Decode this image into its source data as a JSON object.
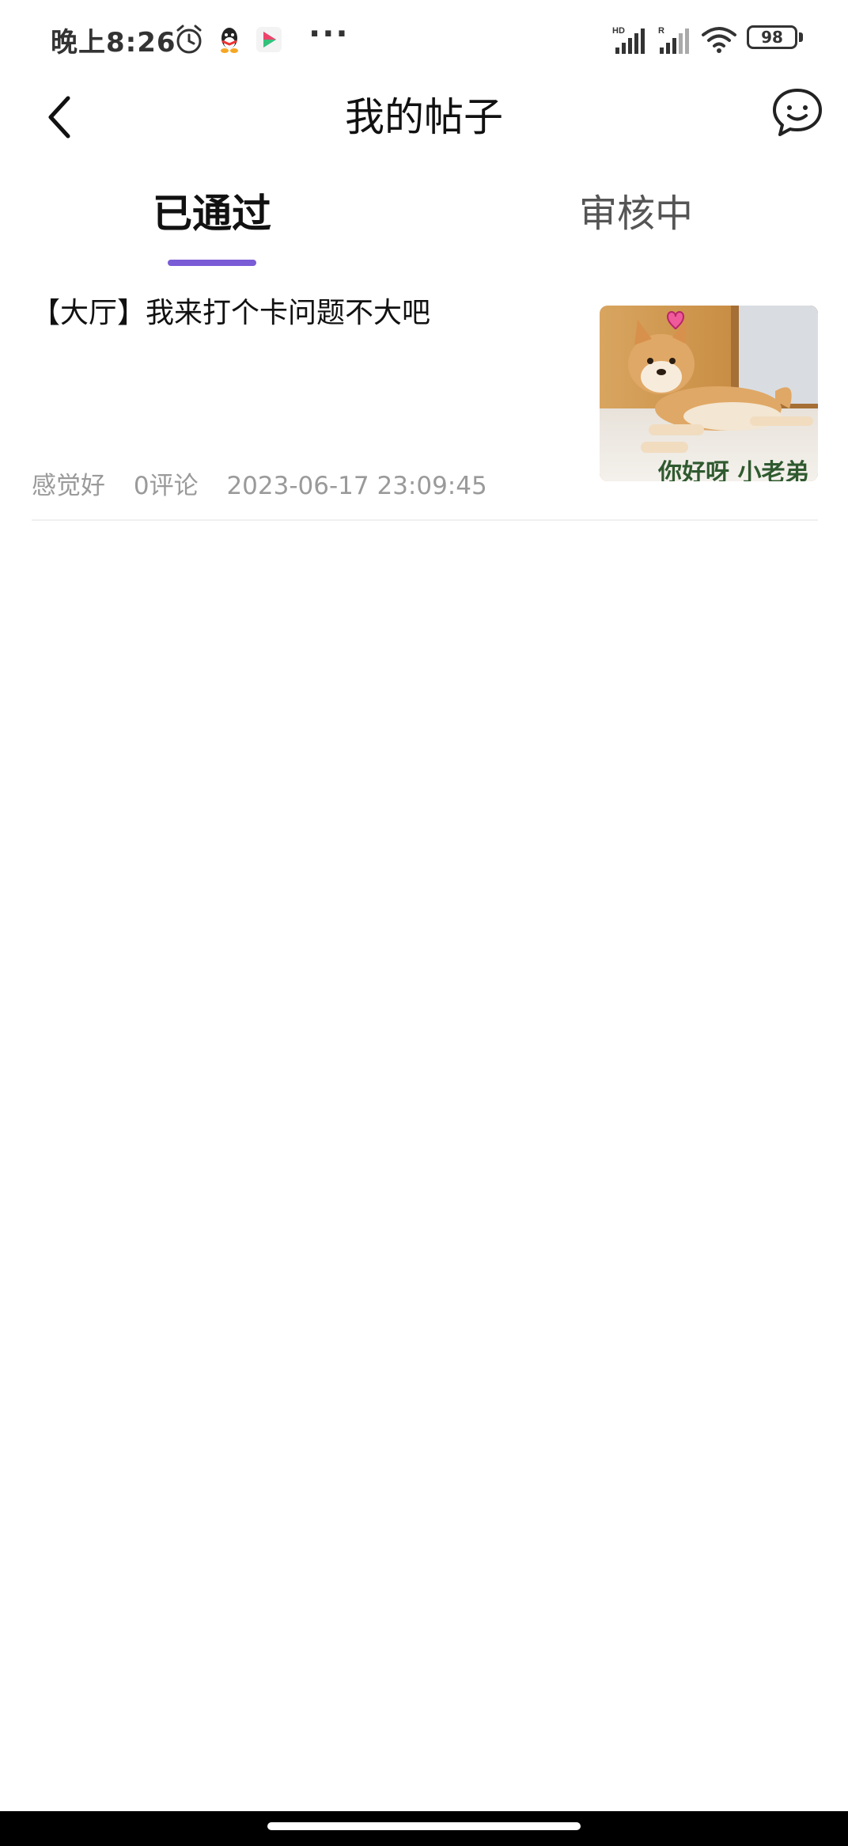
{
  "status_bar": {
    "time": "晚上8:26",
    "more": "···",
    "battery": "98",
    "signal_hd_label": "HD",
    "signal_r_label": "R",
    "icons": [
      "alarm-icon",
      "qq-icon",
      "play-icon",
      "signal-icon",
      "wifi-icon",
      "battery-icon"
    ]
  },
  "header": {
    "title": "我的帖子",
    "back_icon": "chevron-left-icon",
    "message_icon": "chat-bubble-icon"
  },
  "tabs": [
    {
      "label": "已通过",
      "active": true
    },
    {
      "label": "审核中",
      "active": false
    }
  ],
  "colors": {
    "accent": "#7a5cd6",
    "meta_text": "#9a9a9a",
    "divider": "#f0f0f0"
  },
  "posts": [
    {
      "title": "【大厅】我来打个卡问题不大吧",
      "author": "感觉好",
      "comments": "0评论",
      "datetime": "2023-06-17 23:09:45",
      "thumbnail_caption": "你好呀 小老弟",
      "thumbnail_icon": "shiba-dog-image"
    }
  ]
}
